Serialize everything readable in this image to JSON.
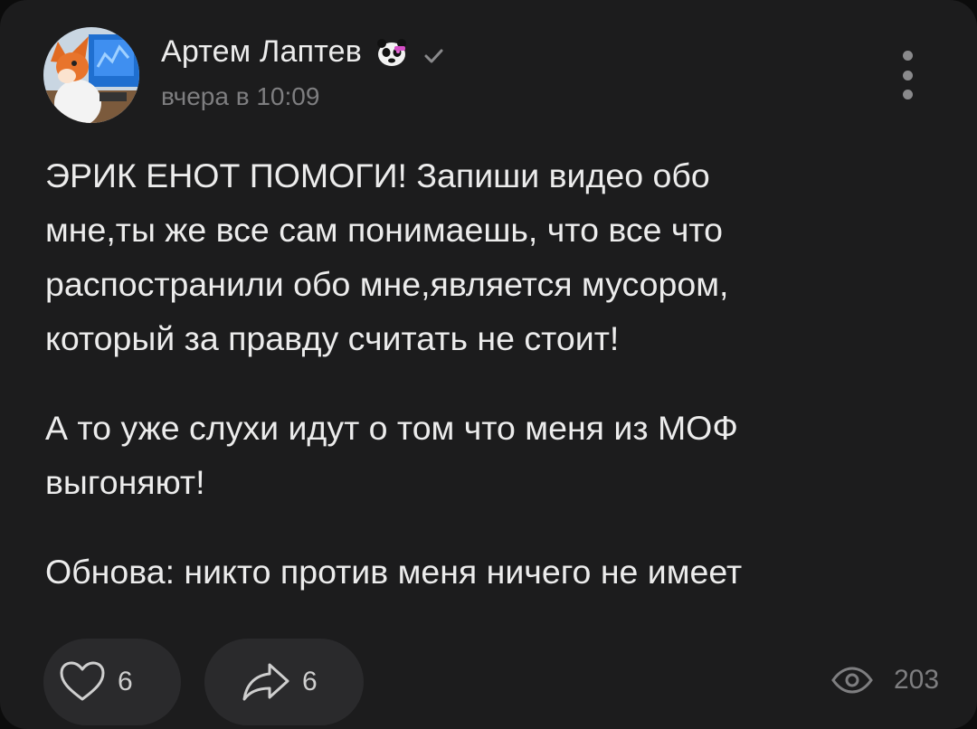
{
  "post": {
    "author": {
      "name": "Артем Лаптев",
      "avatar_icon": "fox-avatar-icon",
      "badge_icon": "panda-sticker-icon",
      "verified_icon": "checkmark-icon"
    },
    "time": "вчера в 10:09",
    "menu_icon": "vertical-dots-icon",
    "paragraphs": [
      "ЭРИК ЕНОТ ПОМОГИ! Запиши видео обо\nмне,ты же все сам понимаешь, что все что\nраспостранили обо мне,является мусором,\nкоторый за правду считать не стоит!",
      "А то уже слухи идут о том что меня из МОФ\nвыгоняют!",
      "Обнова: никто против меня ничего не имеет"
    ]
  },
  "actions": {
    "likes": {
      "icon": "heart-icon",
      "count": "6"
    },
    "shares": {
      "icon": "share-arrow-icon",
      "count": "6"
    },
    "views": {
      "icon": "eye-icon",
      "count": "203"
    }
  },
  "colors": {
    "background": "#1c1c1d",
    "pill": "#2a2a2c",
    "text": "#ececec",
    "muted": "#7e7e80"
  }
}
